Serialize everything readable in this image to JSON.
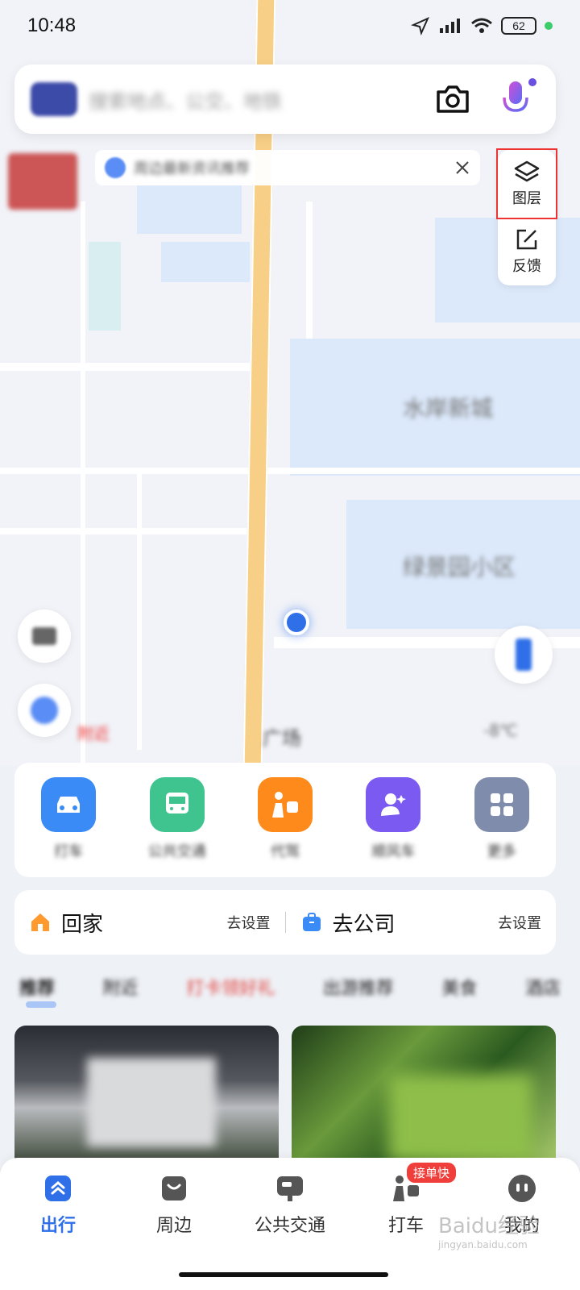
{
  "status_bar": {
    "time": "10:48",
    "battery": "62"
  },
  "search": {
    "placeholder": "搜索地点、公交、地铁"
  },
  "tip": {
    "text": "周边最新资讯推荐"
  },
  "side_panel": {
    "layer_label": "图层",
    "feedback_label": "反馈"
  },
  "map": {
    "location_label": "广场",
    "bottom_left_label": "附近",
    "bottom_right_label": "-8℃"
  },
  "services": [
    {
      "label": "打车",
      "color": "#3a8bf5",
      "icon": "car-icon"
    },
    {
      "label": "公共交通",
      "color": "#3fc48f",
      "icon": "bus-icon"
    },
    {
      "label": "代驾",
      "color": "#ff8a1c",
      "icon": "driver-icon"
    },
    {
      "label": "顺风车",
      "color": "#7a5af0",
      "icon": "person-star-icon"
    },
    {
      "label": "更多",
      "color": "#7f8cab",
      "icon": "grid-icon"
    }
  ],
  "quick": {
    "home": {
      "title": "回家",
      "action": "去设置"
    },
    "work": {
      "title": "去公司",
      "action": "去设置"
    }
  },
  "tabs": [
    "推荐",
    "附近",
    "打卡领好礼",
    "出游推荐",
    "美食",
    "酒店"
  ],
  "bottom_nav": [
    {
      "label": "出行",
      "active": true,
      "icon": "travel-icon"
    },
    {
      "label": "周边",
      "active": false,
      "icon": "shop-icon"
    },
    {
      "label": "公共交通",
      "active": false,
      "icon": "bus-icon"
    },
    {
      "label": "打车",
      "active": false,
      "icon": "taxi-icon",
      "badge": "接单快"
    },
    {
      "label": "我的",
      "active": false,
      "icon": "profile-icon"
    }
  ],
  "watermark": {
    "text": "Baidu经验",
    "sub": "jingyan.baidu.com"
  }
}
